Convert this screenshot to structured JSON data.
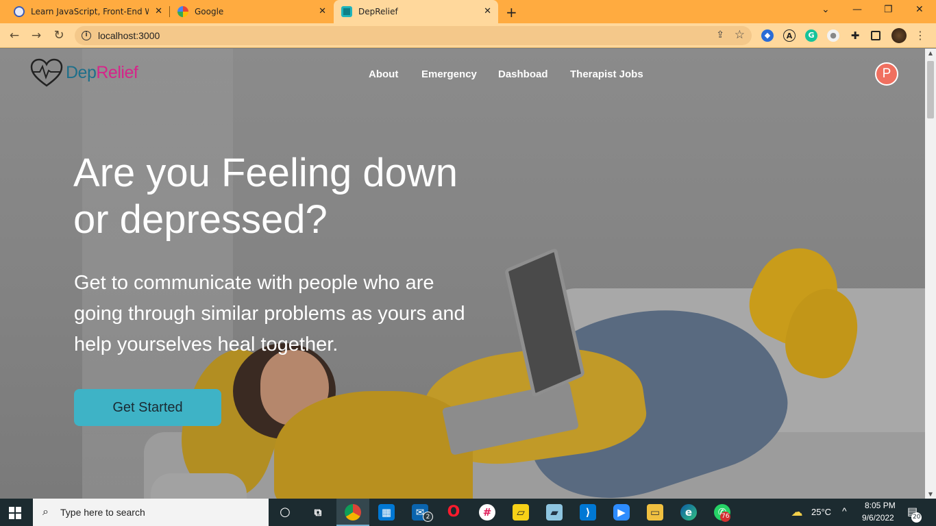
{
  "browser": {
    "tabs": [
      {
        "title": "Learn JavaScript, Front-End Web",
        "close": "✕",
        "favicon": "fcc-icon",
        "active": false
      },
      {
        "title": "Google",
        "close": "✕",
        "favicon": "google-icon",
        "active": false
      },
      {
        "title": "DepRelief",
        "close": "✕",
        "favicon": "deprelief-icon",
        "active": true
      }
    ],
    "new_tab": "+",
    "window_controls": [
      "⌄",
      "—",
      "❐",
      "✕"
    ],
    "url": "localhost:3000",
    "colors": {
      "tabbar": "#ffab40",
      "toolbar": "#ffd89c"
    }
  },
  "site": {
    "logo": {
      "dep": "Dep",
      "relief": "Relief"
    },
    "nav": [
      "About",
      "Emergency",
      "Dashboad",
      "Therapist Jobs"
    ],
    "avatar_letter": "P",
    "headline_line1": "Are you Feeling down",
    "headline_line2": "or depressed?",
    "subtext_line1": "Get to communicate with people who are",
    "subtext_line2": "going through similar problems as yours and",
    "subtext_line3": "help yourselves heal together.",
    "cta": "Get Started",
    "colors": {
      "cta": "#3eb3c6",
      "logo_dep": "#1e6f8a",
      "logo_relief": "#d6258a",
      "avatar": "#f07060"
    }
  },
  "taskbar": {
    "search_placeholder": "Type here to search",
    "mail_badge": "2",
    "whatsapp_badge": "76",
    "weather": "25°C",
    "time": "8:05 PM",
    "date": "9/6/2022",
    "notifications": "20"
  }
}
